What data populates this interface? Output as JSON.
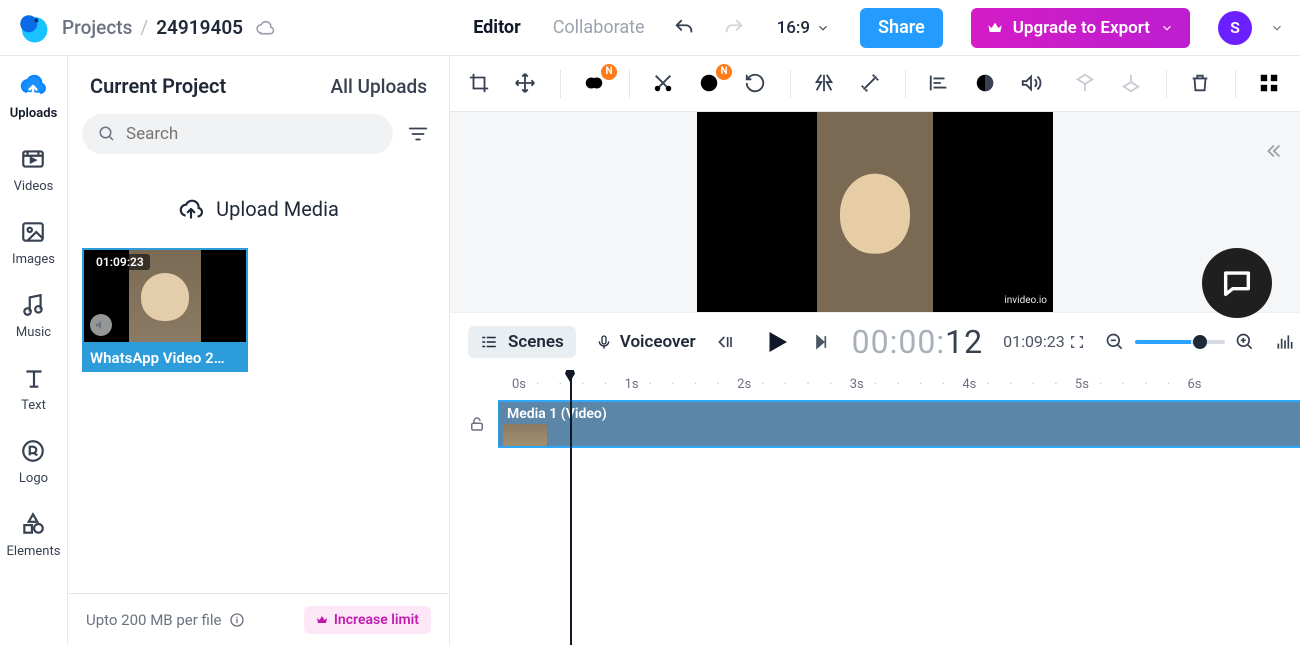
{
  "header": {
    "projects_label": "Projects",
    "project_id": "24919405",
    "tab_editor": "Editor",
    "tab_collaborate": "Collaborate",
    "aspect_ratio": "16:9",
    "share_label": "Share",
    "export_label": "Upgrade to Export",
    "avatar_initial": "S"
  },
  "rail": {
    "uploads": "Uploads",
    "videos": "Videos",
    "images": "Images",
    "music": "Music",
    "text": "Text",
    "logo": "Logo",
    "elements": "Elements"
  },
  "panel": {
    "current_label": "Current Project",
    "all_label": "All Uploads",
    "search_placeholder": "Search",
    "upload_label": "Upload Media",
    "limit_text": "Upto 200 MB per file",
    "increase_label": "Increase limit",
    "media": [
      {
        "duration": "01:09:23",
        "filename": "WhatsApp Video 2…"
      }
    ]
  },
  "player": {
    "scenes_label": "Scenes",
    "voiceover_label": "Voiceover",
    "timecode_prefix": "00:00:",
    "timecode_suffix": "12",
    "total_time": "01:09:23",
    "ruler": [
      "0s",
      "1s",
      "2s",
      "3s",
      "4s",
      "5s",
      "6s"
    ],
    "clip_label": "Media 1 (Video)",
    "watermark": "invideo.io",
    "badge": "N"
  }
}
